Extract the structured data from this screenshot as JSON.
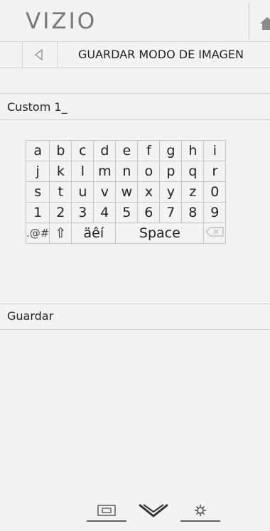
{
  "header": {
    "logo": "VIZIO",
    "home_icon": "home-icon"
  },
  "nav": {
    "title": "GUARDAR MODO DE IMAGEN",
    "back_icon": "back-triangle-icon"
  },
  "input": {
    "value": "Custom 1_"
  },
  "keyboard": {
    "rows": [
      [
        "a",
        "b",
        "c",
        "d",
        "e",
        "f",
        "g",
        "h",
        "i"
      ],
      [
        "j",
        "k",
        "l",
        "m",
        "n",
        "o",
        "p",
        "q",
        "r"
      ],
      [
        "s",
        "t",
        "u",
        "v",
        "w",
        "x",
        "y",
        "z",
        "0"
      ],
      [
        "1",
        "2",
        "3",
        "4",
        "5",
        "6",
        "7",
        "8",
        "9"
      ]
    ],
    "special": {
      "symbols": ".@#",
      "shift": "⇧",
      "accents": "äêí",
      "space": "Space",
      "backspace_icon": "backspace-icon"
    }
  },
  "actions": {
    "save": "Guardar"
  },
  "bottom": {
    "icons": [
      "input-picture-icon",
      "down-chevron-icon",
      "settings-gear-icon"
    ]
  },
  "colors": {
    "background": "#f3f3f3",
    "text": "#222222",
    "divider": "#d4d4d4"
  }
}
